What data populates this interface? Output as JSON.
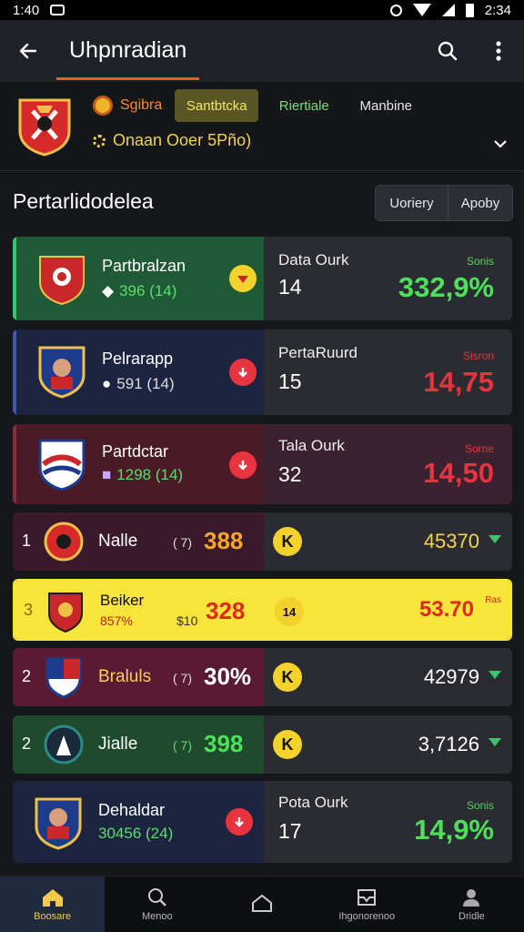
{
  "status": {
    "time": "1:40",
    "clock_right": "2:34"
  },
  "app_bar": {
    "title": "Uhpnradian"
  },
  "team": {
    "chip_label": "Sgibra",
    "tabs": [
      "Santbtcka",
      "Riertiale",
      "Manbine"
    ],
    "subtitle": "Onaan Ooer 5Pño)"
  },
  "section": {
    "title": "Pertarlidodelea",
    "seg_buttons": [
      "Uoriery",
      "Apoby"
    ]
  },
  "cards": [
    {
      "name": "Partbralzan",
      "stat": "396 (14)",
      "label": "Data Ourk",
      "num": "14",
      "tag": "Sonis",
      "value": "332,9%",
      "trend": "up"
    },
    {
      "name": "Pelrarapp",
      "stat": "591 (14)",
      "label": "PertaRuurd",
      "num": "15",
      "tag": "Sisron",
      "value": "14,75",
      "trend": "down"
    },
    {
      "name": "Partdctar",
      "stat": "1298 (14)",
      "label": "Tala Ourk",
      "num": "32",
      "tag": "Sorne",
      "value": "14,50",
      "trend": "down"
    },
    {
      "name": "Dehaldar",
      "stat": "30456 (24)",
      "label": "Pota Ourk",
      "num": "17",
      "tag": "Sonis",
      "value": "14,9%",
      "trend": "down"
    }
  ],
  "rows": [
    {
      "rank": "1",
      "name": "Nalle",
      "small": "( 7)",
      "score": "388",
      "k": "K",
      "value": "45370"
    },
    {
      "rank": "3",
      "name": "Beiker",
      "sub": "857%",
      "small": "$10",
      "score": "328",
      "k": "14",
      "value": "53.70",
      "tag": "Ras"
    },
    {
      "rank": "2",
      "name": "Braluls",
      "small": "( 7)",
      "score": "30%",
      "k": "K",
      "value": "42979"
    },
    {
      "rank": "2",
      "name": "Jialle",
      "small": "( 7)",
      "score": "398",
      "k": "K",
      "value": "3,7126"
    }
  ],
  "bottom_nav": [
    "Boosare",
    "Menoo",
    "",
    "Ihgonorenoo",
    "Dridle"
  ],
  "colors": {
    "accent_orange": "#e85a2a",
    "green_value": "#4ee05a",
    "red_value": "#e8343f",
    "yellow_row": "#f7e53a",
    "nav_active": "#f2c94c"
  }
}
